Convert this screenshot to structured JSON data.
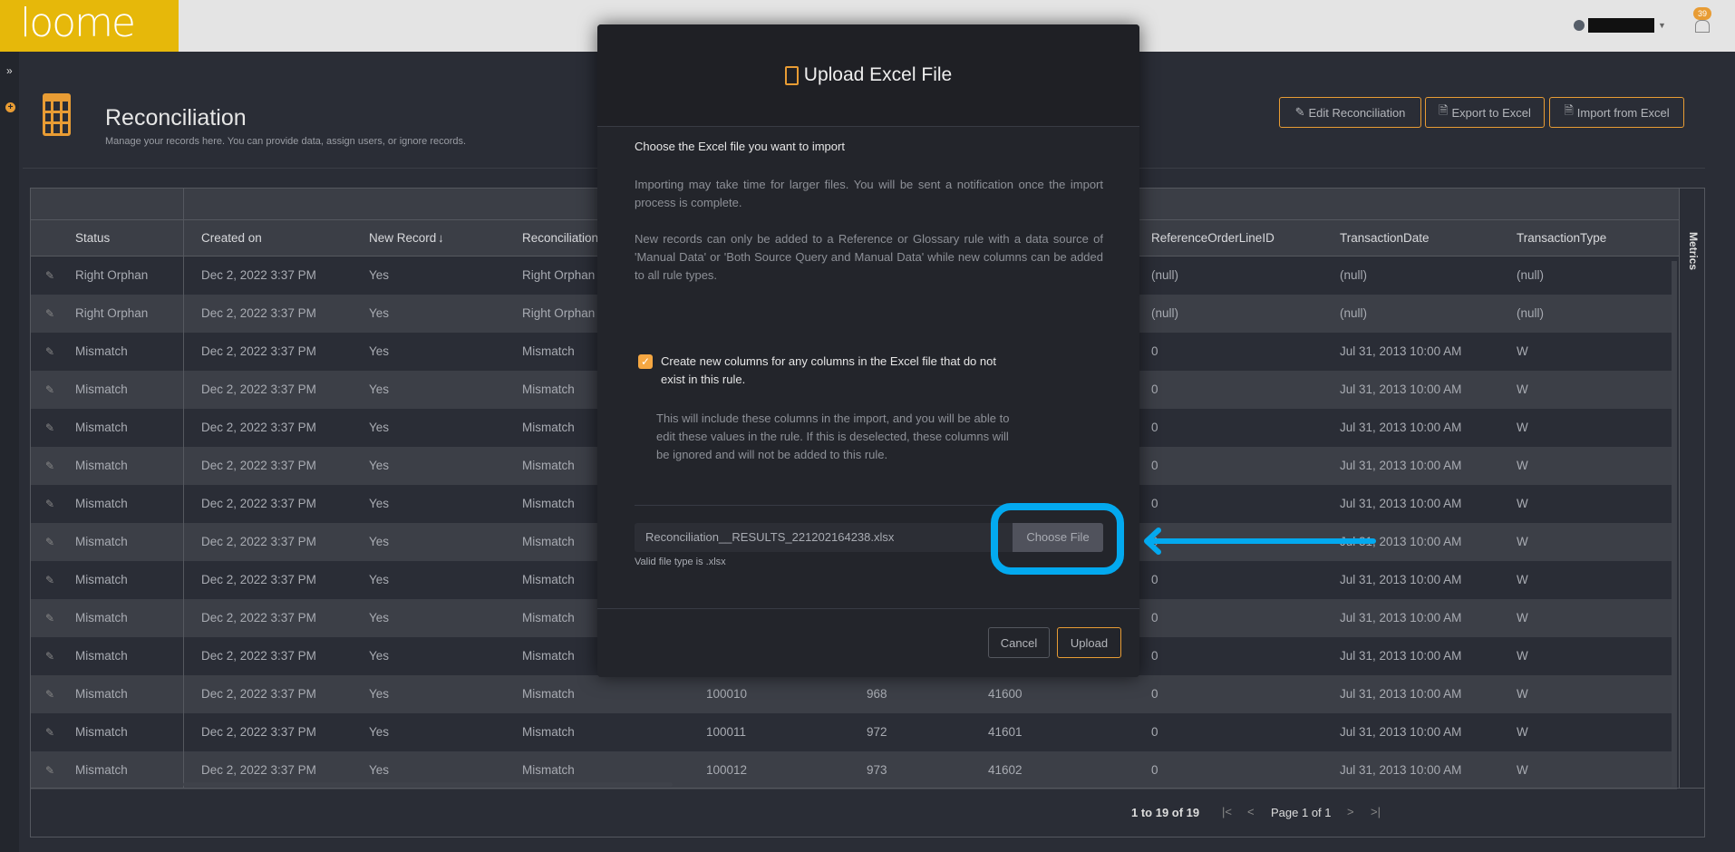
{
  "app": {
    "logo_text": "loome",
    "notification_count": "39"
  },
  "page": {
    "title": "Reconciliation",
    "subtitle": "Manage your records here. You can provide data, assign users, or ignore records."
  },
  "toolbar": {
    "edit": "Edit Reconciliation",
    "export": "Export to Excel",
    "import": "Import from Excel"
  },
  "grid": {
    "columns": [
      "Status",
      "Created on",
      "New Record",
      "Reconciliation",
      "",
      "",
      "",
      "ReferenceOrderLineID",
      "TransactionDate",
      "TransactionType"
    ],
    "sort_icon": "arrow-down-icon",
    "rows": [
      [
        "Right Orphan",
        "Dec 2, 2022 3:37 PM",
        "Yes",
        "Right Orphan",
        "",
        "",
        "",
        "(null)",
        "(null)",
        "(null)"
      ],
      [
        "Right Orphan",
        "Dec 2, 2022 3:37 PM",
        "Yes",
        "Right Orphan",
        "",
        "",
        "",
        "(null)",
        "(null)",
        "(null)"
      ],
      [
        "Mismatch",
        "Dec 2, 2022 3:37 PM",
        "Yes",
        "Mismatch",
        "",
        "",
        "",
        "0",
        "Jul 31, 2013 10:00 AM",
        "W"
      ],
      [
        "Mismatch",
        "Dec 2, 2022 3:37 PM",
        "Yes",
        "Mismatch",
        "",
        "",
        "",
        "0",
        "Jul 31, 2013 10:00 AM",
        "W"
      ],
      [
        "Mismatch",
        "Dec 2, 2022 3:37 PM",
        "Yes",
        "Mismatch",
        "",
        "",
        "",
        "0",
        "Jul 31, 2013 10:00 AM",
        "W"
      ],
      [
        "Mismatch",
        "Dec 2, 2022 3:37 PM",
        "Yes",
        "Mismatch",
        "",
        "",
        "",
        "0",
        "Jul 31, 2013 10:00 AM",
        "W"
      ],
      [
        "Mismatch",
        "Dec 2, 2022 3:37 PM",
        "Yes",
        "Mismatch",
        "",
        "",
        "",
        "0",
        "Jul 31, 2013 10:00 AM",
        "W"
      ],
      [
        "Mismatch",
        "Dec 2, 2022 3:37 PM",
        "Yes",
        "Mismatch",
        "",
        "",
        "",
        "0",
        "Jul 31, 2013 10:00 AM",
        "W"
      ],
      [
        "Mismatch",
        "Dec 2, 2022 3:37 PM",
        "Yes",
        "Mismatch",
        "",
        "",
        "",
        "0",
        "Jul 31, 2013 10:00 AM",
        "W"
      ],
      [
        "Mismatch",
        "Dec 2, 2022 3:37 PM",
        "Yes",
        "Mismatch",
        "",
        "",
        "",
        "0",
        "Jul 31, 2013 10:00 AM",
        "W"
      ],
      [
        "Mismatch",
        "Dec 2, 2022 3:37 PM",
        "Yes",
        "Mismatch",
        "",
        "",
        "",
        "0",
        "Jul 31, 2013 10:00 AM",
        "W"
      ],
      [
        "Mismatch",
        "Dec 2, 2022 3:37 PM",
        "Yes",
        "Mismatch",
        "100010",
        "968",
        "41600",
        "0",
        "Jul 31, 2013 10:00 AM",
        "W"
      ],
      [
        "Mismatch",
        "Dec 2, 2022 3:37 PM",
        "Yes",
        "Mismatch",
        "100011",
        "972",
        "41601",
        "0",
        "Jul 31, 2013 10:00 AM",
        "W"
      ],
      [
        "Mismatch",
        "Dec 2, 2022 3:37 PM",
        "Yes",
        "Mismatch",
        "100012",
        "973",
        "41602",
        "0",
        "Jul 31, 2013 10:00 AM",
        "W"
      ]
    ],
    "metrics_label": "Metrics",
    "pager": {
      "summary": "1 to 19 of 19",
      "page": "Page 1 of 1"
    }
  },
  "modal": {
    "title": "Upload Excel File",
    "lead": "Choose the Excel file you want to import",
    "p1": "Importing may take time for larger files. You will be sent a notification once the import process is complete.",
    "p2": "New records can only be added to a Reference or Glossary rule with a data source of 'Manual Data' or 'Both Source Query and Manual Data' while new columns can be added to all rule types.",
    "checkbox_label": "Create new columns for any columns in the Excel file that do not exist in this rule.",
    "checkbox_checked": true,
    "checkbox_help": "This will include these columns in the import, and you will be able to edit these values in the rule. If this is deselected, these columns will be ignored and will not be added to this rule.",
    "file_value": "Reconciliation__RESULTS_221202164238.xlsx",
    "choose_label": "Choose File",
    "valid_hint": "Valid file type is .xlsx",
    "cancel": "Cancel",
    "upload": "Upload"
  },
  "colors": {
    "accent": "#e89c34",
    "logo_bg": "#e6b80a",
    "highlight": "#03a9ef"
  }
}
